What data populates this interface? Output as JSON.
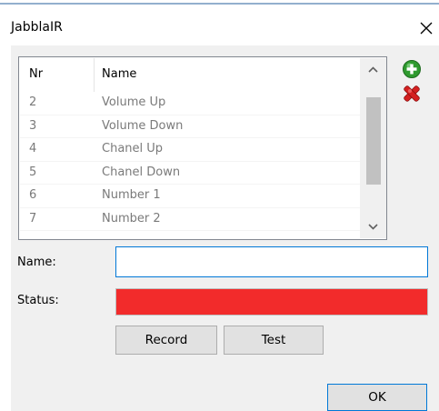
{
  "window": {
    "title": "JabblaIR"
  },
  "list": {
    "columns": [
      "Nr",
      "Name"
    ],
    "rows": [
      {
        "nr": "2",
        "name": "Volume Up"
      },
      {
        "nr": "3",
        "name": "Volume Down"
      },
      {
        "nr": "4",
        "name": "Chanel Up"
      },
      {
        "nr": "5",
        "name": "Chanel Down"
      },
      {
        "nr": "6",
        "name": "Number 1"
      },
      {
        "nr": "7",
        "name": "Number 2"
      }
    ]
  },
  "icons": {
    "add": "add-circle-icon",
    "delete": "delete-x-icon",
    "close": "close-icon",
    "scroll_up": "chevron-up-icon",
    "scroll_down": "chevron-down-icon"
  },
  "form": {
    "name_label": "Name:",
    "name_value": "",
    "status_label": "Status:",
    "status_color": "#f22b2b"
  },
  "buttons": {
    "record": "Record",
    "test": "Test",
    "ok": "OK"
  }
}
